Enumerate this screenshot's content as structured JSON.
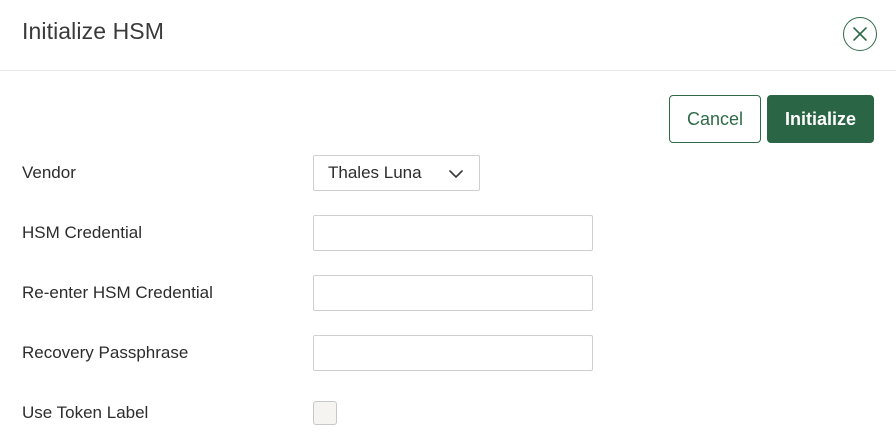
{
  "dialog": {
    "title": "Initialize HSM",
    "close_icon": "close-circle-icon"
  },
  "actions": {
    "cancel_label": "Cancel",
    "initialize_label": "Initialize"
  },
  "form": {
    "vendor": {
      "label": "Vendor",
      "selected": "Thales Luna",
      "icon": "chevron-down-icon"
    },
    "hsm_credential": {
      "label": "HSM Credential",
      "value": "",
      "placeholder": ""
    },
    "reenter_credential": {
      "label": "Re-enter HSM Credential",
      "value": "",
      "placeholder": ""
    },
    "recovery_passphrase": {
      "label": "Recovery Passphrase",
      "value": "",
      "placeholder": ""
    },
    "use_token_label": {
      "label": "Use Token Label",
      "checked": false
    }
  },
  "colors": {
    "accent": "#2a6545",
    "border": "#cfcfcf",
    "text": "#2c2c2c"
  }
}
